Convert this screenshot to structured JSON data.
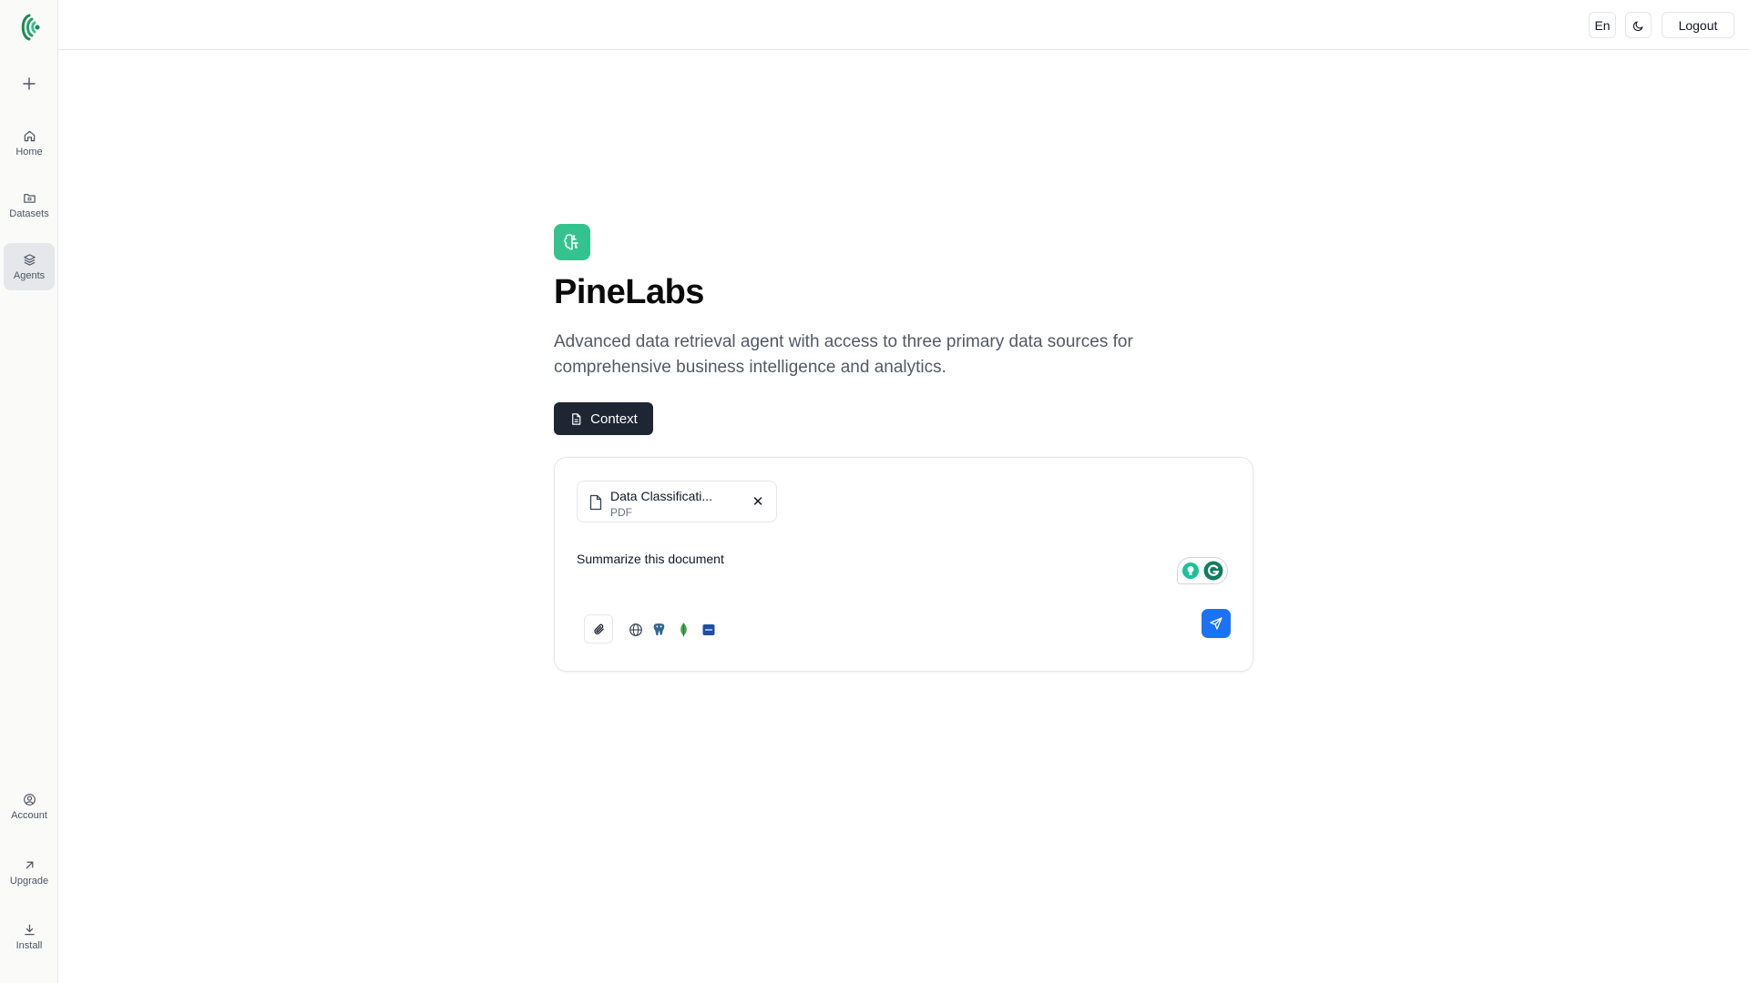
{
  "sidebar": {
    "logo_icon": "brand-logo-icon",
    "new_icon": "plus-icon",
    "items": [
      {
        "label": "Home",
        "icon": "home-icon"
      },
      {
        "label": "Datasets",
        "icon": "folder-icon"
      },
      {
        "label": "Agents",
        "icon": "layers-icon",
        "active": true
      },
      {
        "label": "Account",
        "icon": "user-circle-icon"
      },
      {
        "label": "Upgrade",
        "icon": "arrow-up-right-icon"
      },
      {
        "label": "Install",
        "icon": "download-icon"
      }
    ]
  },
  "topbar": {
    "language": "En",
    "theme_icon": "moon-icon",
    "logout_label": "Logout"
  },
  "agent": {
    "icon": "brain-icon",
    "name": "PineLabs",
    "description": "Advanced data retrieval agent with access to three primary data sources for comprehensive business intelligence and analytics.",
    "context_label": "Context"
  },
  "chat": {
    "attachment": {
      "name": "Data Classificati...",
      "type": "PDF"
    },
    "input_value": "Summarize this document",
    "sources": [
      "globe-icon",
      "postgres-icon",
      "mongodb-icon",
      "database-icon"
    ]
  },
  "colors": {
    "agent_accent": "#34c38f",
    "context_button": "#1e2633",
    "send_button": "#1a73f5"
  }
}
